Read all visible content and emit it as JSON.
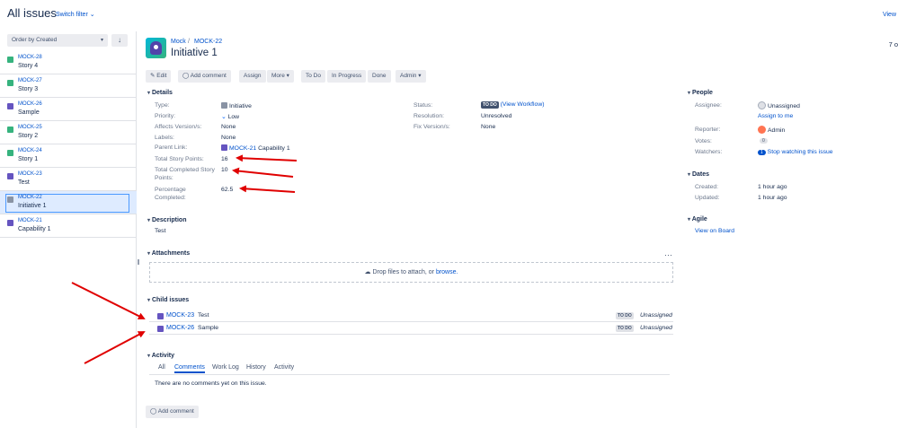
{
  "header": {
    "title": "All issues",
    "switch_filter": "Switch filter",
    "view_link": "View",
    "clip_right": "7 o"
  },
  "sidebar": {
    "order_by": "Order by Created",
    "items": [
      {
        "key": "MOCK-28",
        "summary": "Story 4",
        "type": "story"
      },
      {
        "key": "MOCK-27",
        "summary": "Story 3",
        "type": "story"
      },
      {
        "key": "MOCK-26",
        "summary": "Sample",
        "type": "task"
      },
      {
        "key": "MOCK-25",
        "summary": "Story 2",
        "type": "story"
      },
      {
        "key": "MOCK-24",
        "summary": "Story 1",
        "type": "story"
      },
      {
        "key": "MOCK-23",
        "summary": "Test",
        "type": "task"
      },
      {
        "key": "MOCK-22",
        "summary": "Initiative 1",
        "type": "initiative"
      },
      {
        "key": "MOCK-21",
        "summary": "Capability 1",
        "type": "capability"
      }
    ]
  },
  "issue": {
    "project": "Mock",
    "key": "MOCK-22",
    "title": "Initiative 1"
  },
  "toolbar": {
    "edit": "Edit",
    "add_comment": "Add comment",
    "assign": "Assign",
    "more": "More",
    "to_do": "To Do",
    "in_progress": "In Progress",
    "done": "Done",
    "admin": "Admin"
  },
  "details": {
    "heading": "Details",
    "type_label": "Type:",
    "type_value": "Initiative",
    "priority_label": "Priority:",
    "priority_value": "Low",
    "affects_label": "Affects Version/s:",
    "affects_value": "None",
    "labels_label": "Labels:",
    "labels_value": "None",
    "parent_label": "Parent Link:",
    "parent_key": "MOCK-21",
    "parent_summary": "Capability 1",
    "tsp_label": "Total Story Points:",
    "tsp_value": "16",
    "tcsp_label_1": "Total Completed Story",
    "tcsp_label_2": "Points:",
    "tcsp_value": "10",
    "pct_label_1": "Percentage",
    "pct_label_2": "Completed:",
    "pct_value": "62.5",
    "status_label": "Status:",
    "status_value": "TO DO",
    "view_workflow": "(View Workflow)",
    "resolution_label": "Resolution:",
    "resolution_value": "Unresolved",
    "fix_label": "Fix Version/s:",
    "fix_value": "None"
  },
  "description": {
    "heading": "Description",
    "text": "Test"
  },
  "attachments": {
    "heading": "Attachments",
    "drop_text": "Drop files to attach, or",
    "browse": "browse."
  },
  "child_issues": {
    "heading": "Child issues",
    "rows": [
      {
        "key": "MOCK-23",
        "summary": "Test",
        "status": "TO DO",
        "assignee": "Unassigned"
      },
      {
        "key": "MOCK-26",
        "summary": "Sample",
        "status": "TO DO",
        "assignee": "Unassigned"
      }
    ]
  },
  "activity": {
    "heading": "Activity",
    "tabs": [
      "All",
      "Comments",
      "Work Log",
      "History",
      "Activity"
    ],
    "empty": "There are no comments yet on this issue.",
    "add_comment": "Add comment"
  },
  "people": {
    "heading": "People",
    "assignee_label": "Assignee:",
    "assignee_value": "Unassigned",
    "assign_to_me": "Assign to me",
    "reporter_label": "Reporter:",
    "reporter_value": "Admin",
    "votes_label": "Votes:",
    "votes_value": "0",
    "watchers_label": "Watchers:",
    "watchers_count": "1",
    "watchers_text": "Stop watching this issue"
  },
  "dates": {
    "heading": "Dates",
    "created_label": "Created:",
    "created_value": "1 hour ago",
    "updated_label": "Updated:",
    "updated_value": "1 hour ago"
  },
  "agile": {
    "heading": "Agile",
    "view_on_board": "View on Board"
  },
  "colors": {
    "link": "#0052cc",
    "annotation_arrow": "#e00000",
    "selected_bg": "#deebff"
  }
}
